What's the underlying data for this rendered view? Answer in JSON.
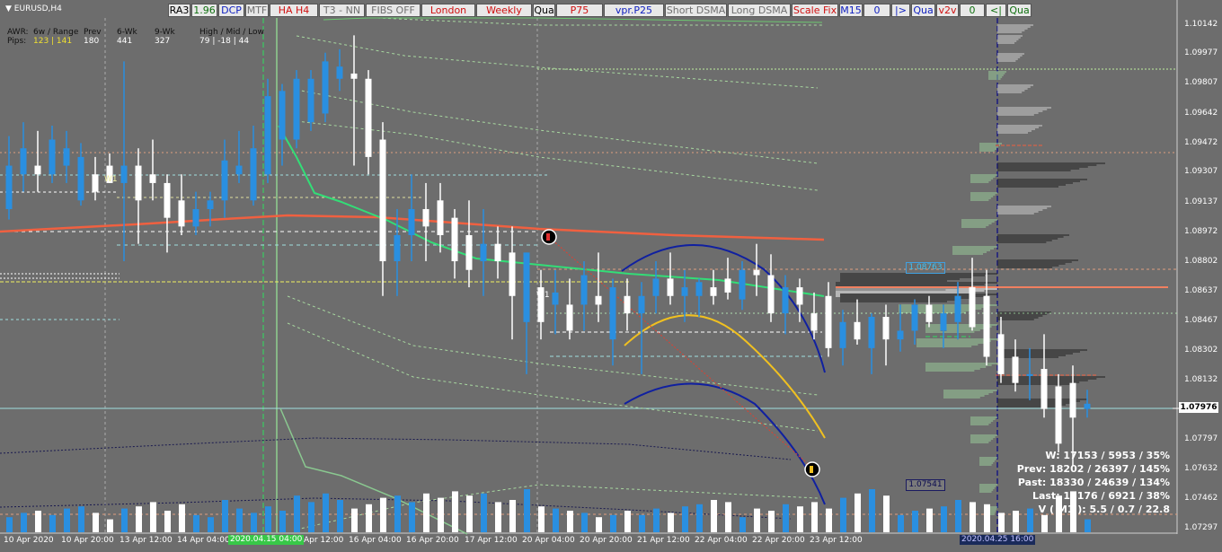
{
  "window": {
    "symbol_title": "EURUSD,H4"
  },
  "toolbar": [
    {
      "label": "RA3",
      "color": "#000000"
    },
    {
      "label": "1.96",
      "color": "#107010"
    },
    {
      "label": "DCP",
      "color": "#1020c0"
    },
    {
      "label": "MTF",
      "color": "#707070"
    },
    {
      "label": "HA H4",
      "color": "#d01010"
    },
    {
      "label": "T3 - NN",
      "color": "#707070"
    },
    {
      "label": "FIBS OFF",
      "color": "#707070"
    },
    {
      "label": "London",
      "color": "#d01010"
    },
    {
      "label": "Weekly",
      "color": "#d01010"
    },
    {
      "label": "Qua",
      "color": "#000000"
    },
    {
      "label": "P75",
      "color": "#d01010"
    },
    {
      "label": "vpr.P25",
      "color": "#1020c0"
    },
    {
      "label": "Short DSMA",
      "color": "#707070"
    },
    {
      "label": "Long DSMA",
      "color": "#707070"
    },
    {
      "label": "Scale Fix",
      "color": "#d01010"
    },
    {
      "label": "M15",
      "color": "#1020c0"
    },
    {
      "label": "0",
      "color": "#1020c0"
    },
    {
      "label": "|>",
      "color": "#1020c0"
    },
    {
      "label": "Qua",
      "color": "#1020c0"
    },
    {
      "label": "v2v",
      "color": "#d01010"
    },
    {
      "label": "0",
      "color": "#107010"
    },
    {
      "label": "<|",
      "color": "#107010"
    },
    {
      "label": "Qua",
      "color": "#107010"
    }
  ],
  "header_stats": {
    "awr_label": "AWR:",
    "range_label": "6w / Range",
    "prev_label": "Prev",
    "wk6_label": "6-Wk",
    "wk9_label": "9-Wk",
    "hml_label": "High / Mid / Low",
    "pips_label": "Pips:",
    "range_value": "123 | 141",
    "prev_value": "180",
    "wk6_value": "441",
    "wk9_value": "327",
    "hml_value": "79  |  -18  |  44"
  },
  "price_axis": {
    "labels": [
      "1.10142",
      "1.09977",
      "1.09807",
      "1.09642",
      "1.09472",
      "1.09307",
      "1.09137",
      "1.08972",
      "1.08802",
      "1.08637",
      "1.08467",
      "1.08302",
      "1.08132",
      "1.07797",
      "1.07632",
      "1.07462",
      "1.07297"
    ],
    "current_price": "1.07976",
    "level_marker_1": "1.08763",
    "level_marker_2": "1.07541"
  },
  "time_axis": {
    "labels": [
      "10 Apr 2020",
      "10 Apr 20:00",
      "13 Apr 12:00",
      "14 Apr 04:00",
      "2020.04.15 04:00",
      "Apr 12:00",
      "16 Apr 04:00",
      "16 Apr 20:00",
      "17 Apr 12:00",
      "20 Apr 04:00",
      "20 Apr 20:00",
      "21 Apr 12:00",
      "22 Apr 04:00",
      "22 Apr 20:00",
      "23 Apr 12:00"
    ],
    "profile_date": "2020.04.25 16:00"
  },
  "chart_labels": {
    "w1_left": "W1",
    "w1_right": "W1"
  },
  "stats_panel": {
    "w": "W: 17153 / 5953 / 35%",
    "prev": "Prev: 18202 / 26397 / 145%",
    "past": "Past: 18330 / 24639 / 134%",
    "last": "Last: 18176 / 6921 / 38%",
    "vm1": "V ( M1 ): 5.5 / 0.7 / 22.8"
  },
  "colors": {
    "bull": "#2a8fe0",
    "bear": "#ffffff",
    "ma_fast": "#33dd77",
    "ma_slow": "#f06040",
    "arc": "#1020a0",
    "curve": "#f0c020",
    "envelope": "#a8d8a0",
    "background": "#6d6d6d",
    "current_price_line": "#a0e0e0"
  },
  "chart_data": {
    "type": "candlestick",
    "symbol": "EURUSD",
    "timeframe": "H4",
    "ylim": [
      1.0723,
      1.102
    ],
    "candles": [
      {
        "o": 1.091,
        "h": 1.0952,
        "l": 1.0904,
        "c": 1.0935
      },
      {
        "o": 1.093,
        "h": 1.096,
        "l": 1.092,
        "c": 1.0945
      },
      {
        "o": 1.0935,
        "h": 1.0955,
        "l": 1.092,
        "c": 1.093
      },
      {
        "o": 1.093,
        "h": 1.0958,
        "l": 1.0925,
        "c": 1.095
      },
      {
        "o": 1.0935,
        "h": 1.0955,
        "l": 1.0925,
        "c": 1.0945
      },
      {
        "o": 1.0915,
        "h": 1.0948,
        "l": 1.0912,
        "c": 1.094
      },
      {
        "o": 1.093,
        "h": 1.094,
        "l": 1.0915,
        "c": 1.092
      },
      {
        "o": 1.0935,
        "h": 1.0942,
        "l": 1.0925,
        "c": 1.0925
      },
      {
        "o": 1.0925,
        "h": 1.0995,
        "l": 1.088,
        "c": 1.0935
      },
      {
        "o": 1.0935,
        "h": 1.0945,
        "l": 1.089,
        "c": 1.0915
      },
      {
        "o": 1.093,
        "h": 1.095,
        "l": 1.0915,
        "c": 1.0925
      },
      {
        "o": 1.0925,
        "h": 1.093,
        "l": 1.0885,
        "c": 1.0905
      },
      {
        "o": 1.0915,
        "h": 1.093,
        "l": 1.0895,
        "c": 1.09
      },
      {
        "o": 1.09,
        "h": 1.092,
        "l": 1.0895,
        "c": 1.091
      },
      {
        "o": 1.091,
        "h": 1.092,
        "l": 1.09,
        "c": 1.0915
      },
      {
        "o": 1.0915,
        "h": 1.095,
        "l": 1.0905,
        "c": 1.0938
      },
      {
        "o": 1.093,
        "h": 1.0955,
        "l": 1.0925,
        "c": 1.0935
      },
      {
        "o": 1.0915,
        "h": 1.0958,
        "l": 1.0912,
        "c": 1.0945
      },
      {
        "o": 1.093,
        "h": 1.0985,
        "l": 1.0925,
        "c": 1.0975
      },
      {
        "o": 1.095,
        "h": 1.0982,
        "l": 1.0935,
        "c": 1.0978
      },
      {
        "o": 1.095,
        "h": 1.099,
        "l": 1.0945,
        "c": 1.0985
      },
      {
        "o": 1.096,
        "h": 1.099,
        "l": 1.0955,
        "c": 1.0985
      },
      {
        "o": 1.0965,
        "h": 1.1,
        "l": 1.096,
        "c": 1.0995
      },
      {
        "o": 1.0985,
        "h": 1.1002,
        "l": 1.0978,
        "c": 1.0992
      },
      {
        "o": 1.0988,
        "h": 1.101,
        "l": 1.0935,
        "c": 1.0985
      },
      {
        "o": 1.0985,
        "h": 1.099,
        "l": 1.093,
        "c": 1.094
      },
      {
        "o": 1.095,
        "h": 1.096,
        "l": 1.086,
        "c": 1.088
      },
      {
        "o": 1.088,
        "h": 1.091,
        "l": 1.086,
        "c": 1.0895
      },
      {
        "o": 1.0895,
        "h": 1.093,
        "l": 1.088,
        "c": 1.091
      },
      {
        "o": 1.091,
        "h": 1.0925,
        "l": 1.088,
        "c": 1.09
      },
      {
        "o": 1.0915,
        "h": 1.0925,
        "l": 1.0885,
        "c": 1.0895
      },
      {
        "o": 1.0905,
        "h": 1.091,
        "l": 1.087,
        "c": 1.088
      },
      {
        "o": 1.0895,
        "h": 1.0915,
        "l": 1.0865,
        "c": 1.0875
      },
      {
        "o": 1.088,
        "h": 1.091,
        "l": 1.086,
        "c": 1.089
      },
      {
        "o": 1.089,
        "h": 1.09,
        "l": 1.087,
        "c": 1.088
      },
      {
        "o": 1.0885,
        "h": 1.09,
        "l": 1.0835,
        "c": 1.086
      },
      {
        "o": 1.0845,
        "h": 1.0885,
        "l": 1.0815,
        "c": 1.0885
      },
      {
        "o": 1.0865,
        "h": 1.0875,
        "l": 1.0835,
        "c": 1.0845
      },
      {
        "o": 1.0855,
        "h": 1.0875,
        "l": 1.0838,
        "c": 1.0862
      },
      {
        "o": 1.0855,
        "h": 1.087,
        "l": 1.0835,
        "c": 1.084
      },
      {
        "o": 1.0855,
        "h": 1.088,
        "l": 1.084,
        "c": 1.0872
      },
      {
        "o": 1.086,
        "h": 1.0885,
        "l": 1.0845,
        "c": 1.0855
      },
      {
        "o": 1.0835,
        "h": 1.087,
        "l": 1.082,
        "c": 1.0865
      },
      {
        "o": 1.086,
        "h": 1.087,
        "l": 1.084,
        "c": 1.085
      },
      {
        "o": 1.085,
        "h": 1.0868,
        "l": 1.0815,
        "c": 1.086
      },
      {
        "o": 1.086,
        "h": 1.088,
        "l": 1.085,
        "c": 1.087
      },
      {
        "o": 1.087,
        "h": 1.0885,
        "l": 1.0855,
        "c": 1.086
      },
      {
        "o": 1.086,
        "h": 1.0875,
        "l": 1.0845,
        "c": 1.0865
      },
      {
        "o": 1.086,
        "h": 1.087,
        "l": 1.0848,
        "c": 1.0868
      },
      {
        "o": 1.0865,
        "h": 1.0875,
        "l": 1.0855,
        "c": 1.086
      },
      {
        "o": 1.087,
        "h": 1.0882,
        "l": 1.0858,
        "c": 1.0862
      },
      {
        "o": 1.0858,
        "h": 1.088,
        "l": 1.0852,
        "c": 1.0875
      },
      {
        "o": 1.0875,
        "h": 1.089,
        "l": 1.086,
        "c": 1.0872
      },
      {
        "o": 1.0872,
        "h": 1.0884,
        "l": 1.0845,
        "c": 1.085
      },
      {
        "o": 1.085,
        "h": 1.0872,
        "l": 1.0838,
        "c": 1.0865
      },
      {
        "o": 1.0865,
        "h": 1.087,
        "l": 1.0845,
        "c": 1.0855
      },
      {
        "o": 1.085,
        "h": 1.0862,
        "l": 1.0835,
        "c": 1.084
      },
      {
        "o": 1.086,
        "h": 1.0868,
        "l": 1.0825,
        "c": 1.083
      },
      {
        "o": 1.083,
        "h": 1.0852,
        "l": 1.082,
        "c": 1.0845
      },
      {
        "o": 1.0845,
        "h": 1.0858,
        "l": 1.0832,
        "c": 1.0835
      },
      {
        "o": 1.083,
        "h": 1.085,
        "l": 1.0815,
        "c": 1.0848
      },
      {
        "o": 1.0848,
        "h": 1.0855,
        "l": 1.082,
        "c": 1.0835
      },
      {
        "o": 1.0835,
        "h": 1.0855,
        "l": 1.0828,
        "c": 1.084
      },
      {
        "o": 1.084,
        "h": 1.0858,
        "l": 1.0832,
        "c": 1.0855
      },
      {
        "o": 1.0855,
        "h": 1.086,
        "l": 1.0842,
        "c": 1.0845
      },
      {
        "o": 1.084,
        "h": 1.0855,
        "l": 1.083,
        "c": 1.085
      },
      {
        "o": 1.0845,
        "h": 1.0868,
        "l": 1.0835,
        "c": 1.086
      },
      {
        "o": 1.0865,
        "h": 1.0882,
        "l": 1.084,
        "c": 1.0842
      },
      {
        "o": 1.086,
        "h": 1.0875,
        "l": 1.082,
        "c": 1.0825
      },
      {
        "o": 1.0838,
        "h": 1.0848,
        "l": 1.081,
        "c": 1.0815
      },
      {
        "o": 1.0825,
        "h": 1.0835,
        "l": 1.0805,
        "c": 1.081
      },
      {
        "o": 1.0815,
        "h": 1.083,
        "l": 1.08,
        "c": 1.0815
      },
      {
        "o": 1.0818,
        "h": 1.0838,
        "l": 1.079,
        "c": 1.0795
      },
      {
        "o": 1.0808,
        "h": 1.0815,
        "l": 1.077,
        "c": 1.0775
      },
      {
        "o": 1.081,
        "h": 1.082,
        "l": 1.0762,
        "c": 1.079
      },
      {
        "o": 1.0795,
        "h": 1.0806,
        "l": 1.079,
        "c": 1.0798
      }
    ],
    "volume": [
      0.35,
      0.45,
      0.5,
      0.4,
      0.55,
      0.6,
      0.45,
      0.3,
      0.55,
      0.6,
      0.7,
      0.5,
      0.65,
      0.4,
      0.35,
      0.75,
      0.55,
      0.45,
      0.6,
      0.5,
      0.85,
      0.7,
      0.9,
      0.75,
      0.55,
      0.65,
      0.8,
      0.85,
      0.7,
      0.9,
      0.8,
      0.95,
      0.85,
      0.9,
      0.7,
      0.75,
      1.0,
      0.6,
      0.55,
      0.5,
      0.45,
      0.35,
      0.4,
      0.5,
      0.4,
      0.55,
      0.45,
      0.6,
      0.65,
      0.75,
      0.7,
      0.35,
      0.55,
      0.5,
      0.65,
      0.6,
      0.7,
      0.55,
      0.8,
      0.9,
      1.0,
      0.85,
      0.4,
      0.5,
      0.55,
      0.6,
      0.75,
      0.7,
      0.65,
      0.45,
      0.5,
      0.55,
      0.4,
      0.85,
      0.95,
      0.3
    ]
  }
}
